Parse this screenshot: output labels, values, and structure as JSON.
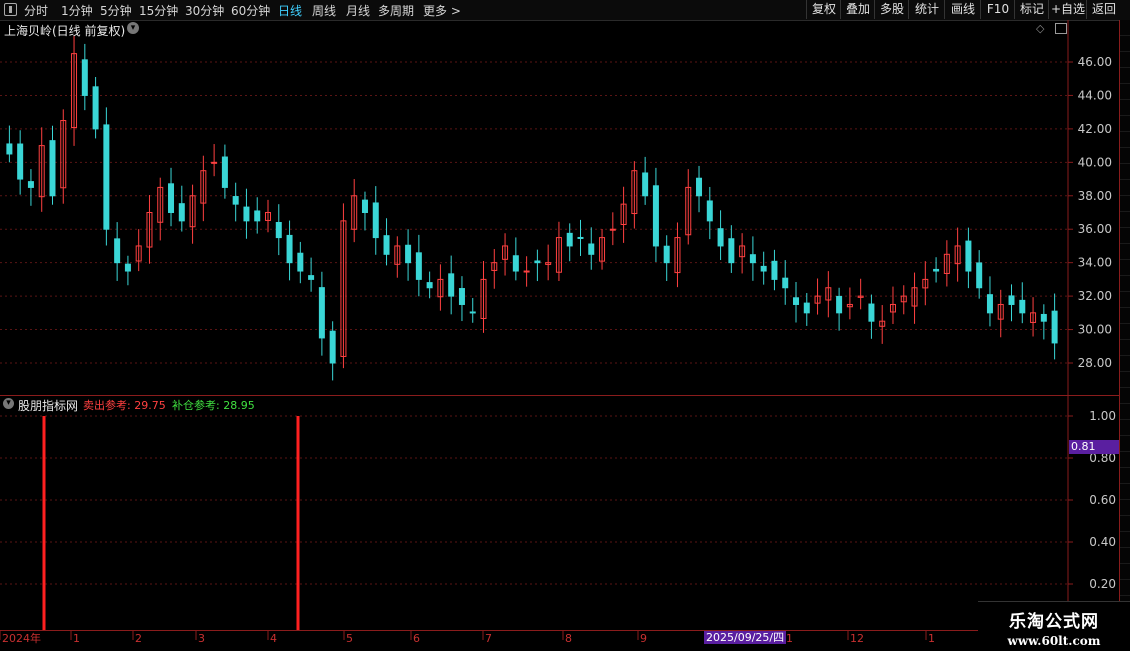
{
  "toolbar": {
    "tabs": [
      {
        "label": "分时"
      },
      {
        "label": "1分钟"
      },
      {
        "label": "5分钟"
      },
      {
        "label": "15分钟"
      },
      {
        "label": "30分钟"
      },
      {
        "label": "60分钟"
      },
      {
        "label": "日线"
      },
      {
        "label": "周线"
      },
      {
        "label": "月线"
      },
      {
        "label": "多周期"
      },
      {
        "label": "更多 >"
      }
    ],
    "active_tab": "日线",
    "right_buttons": [
      {
        "label": "复权"
      },
      {
        "label": "叠加"
      },
      {
        "label": "多股"
      },
      {
        "label": "统计"
      },
      {
        "label": "画线"
      },
      {
        "label": "F10"
      },
      {
        "label": "标记"
      },
      {
        "label": "+自选"
      },
      {
        "label": "返回"
      }
    ]
  },
  "main_chart": {
    "title": "上海贝岭(日线 前复权)",
    "price_ticks": [
      "46.00",
      "44.00",
      "42.00",
      "40.00",
      "38.00",
      "36.00",
      "34.00",
      "32.00",
      "30.00",
      "28.00"
    ],
    "up_color": "#ff4040",
    "down_color": "#3ad6d6"
  },
  "indicator": {
    "name": "股朋指标网",
    "sell_label": "卖出参考: 29.75",
    "buy_label": "补仓参考: 28.95",
    "ticks": [
      "1.00",
      "0.80",
      "0.60",
      "0.40",
      "0.20"
    ],
    "current_value": "0.81",
    "signal_color": "#ff2020"
  },
  "x_axis": {
    "labels": [
      "2024年",
      "1",
      "2",
      "3",
      "4",
      "5",
      "6",
      "7",
      "8",
      "9",
      "1",
      "12",
      "1"
    ],
    "cursor_date": "2025/09/25/四"
  },
  "watermark": {
    "line1": "乐淘公式网",
    "line2": "www.60lt.com"
  },
  "chart_data": {
    "type": "candlestick",
    "title": "上海贝岭(日线 前复权)",
    "ylim": [
      27,
      47.5
    ],
    "ohlc_close_approx": [
      40.5,
      39.0,
      38.5,
      41.0,
      38.0,
      42.5,
      46.5,
      44.0,
      42.0,
      36.0,
      34.0,
      33.5,
      35.0,
      37.0,
      38.5,
      37.0,
      36.5,
      38.0,
      39.5,
      40.0,
      38.5,
      37.5,
      36.5,
      36.5,
      37.0,
      35.5,
      34.0,
      33.5,
      33.0,
      29.5,
      28.0,
      36.5,
      38.0,
      37.0,
      35.5,
      34.5,
      35.0,
      34.0,
      33.0,
      32.5,
      33.0,
      32.0,
      31.5,
      31.0,
      33.0,
      34.0,
      35.0,
      33.5,
      33.5,
      34.0,
      34.0,
      35.5,
      35.0,
      35.5,
      34.5,
      35.5,
      36.0,
      37.5,
      39.5,
      38.0,
      35.0,
      34.0,
      35.5,
      38.5,
      38.0,
      36.5,
      35.0,
      34.0,
      35.0,
      34.0,
      33.5,
      33.0,
      32.5,
      31.5,
      31.0,
      32.0,
      32.5,
      31.0,
      31.5,
      32.0,
      30.5,
      30.5,
      31.5,
      32.0,
      32.5,
      33.0,
      33.5,
      34.5,
      35.0,
      33.5,
      32.5,
      31.0,
      31.5,
      31.5,
      31.0,
      31.0,
      30.5,
      29.2
    ],
    "indicator_signals": [
      0.45,
      2.75
    ]
  }
}
